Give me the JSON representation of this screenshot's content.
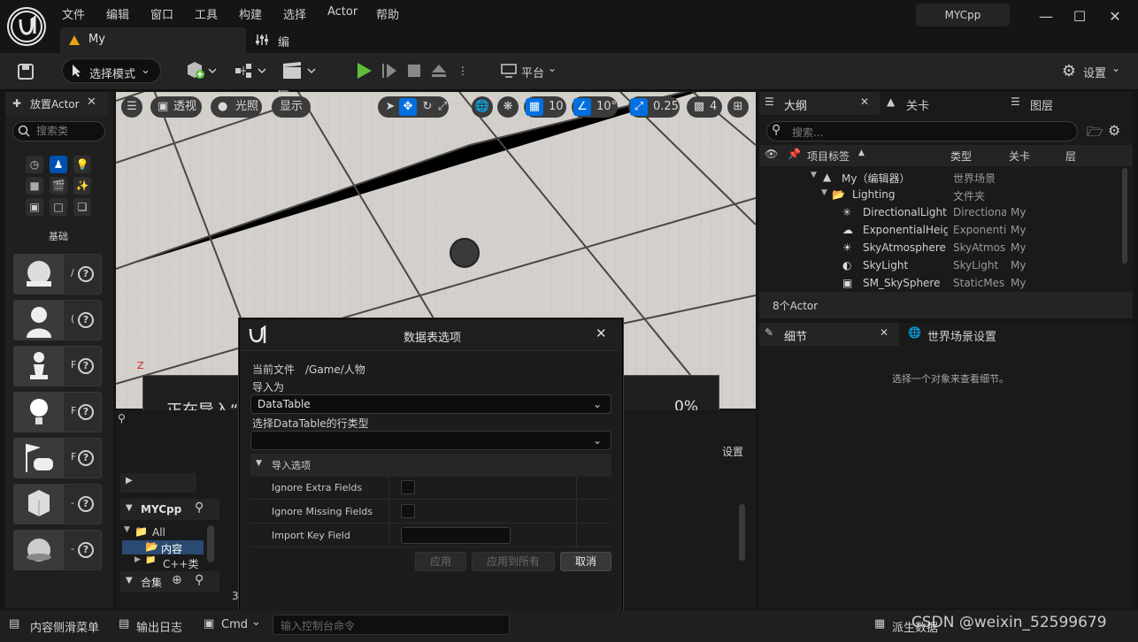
{
  "menu": [
    "文件",
    "编辑",
    "窗口",
    "工具",
    "构建",
    "选择",
    "Actor",
    "帮助"
  ],
  "tabs": {
    "level": "My",
    "prefs": "编辑器偏好设置"
  },
  "project_name": "MYCpp",
  "toolbar": {
    "mode": "选择模式",
    "platform": "平台",
    "settings": "设置"
  },
  "place_actors": {
    "title": "放置Actor",
    "search_placeholder": "搜索类",
    "category_label": "基础",
    "card_cuts": [
      "/",
      "(",
      "F",
      "F",
      "F",
      "-",
      "-"
    ]
  },
  "viewport": {
    "perspective": "透视",
    "lit": "光照",
    "show": "显示",
    "grid_snap": "10",
    "rot_snap": "10°",
    "scale_snap": "0.25",
    "camera_speed": "4"
  },
  "import_progress": {
    "label": "正在导入“",
    "percent": "0%"
  },
  "content": {
    "root": "MYCpp",
    "all": "All",
    "content": "内容",
    "cpp": "C++类",
    "collections": "合集",
    "settings_partial": "设置",
    "count_partial": "3"
  },
  "outliner": {
    "tab_outline": "大纲",
    "tab_levels": "关卡",
    "tab_layers": "图层",
    "search_placeholder": "搜索...",
    "columns": {
      "label": "项目标签",
      "type": "类型",
      "level": "关卡",
      "layer": "层"
    },
    "rows": [
      {
        "label": "My（编辑器）",
        "type": "世界场景",
        "level": ""
      },
      {
        "label": "Lighting",
        "type": "文件夹",
        "level": ""
      },
      {
        "label": "DirectionalLight",
        "type": "Directiona",
        "level": "My"
      },
      {
        "label": "ExponentialHeigl",
        "type": "Exponenti",
        "level": "My"
      },
      {
        "label": "SkyAtmosphere",
        "type": "SkyAtmos",
        "level": "My"
      },
      {
        "label": "SkyLight",
        "type": "SkyLight",
        "level": "My"
      },
      {
        "label": "SM_SkySphere",
        "type": "StaticMes",
        "level": "My"
      }
    ],
    "count": "8个Actor"
  },
  "details": {
    "tab_details": "细节",
    "tab_world": "世界场景设置",
    "empty_text": "选择一个对象来查看细节。"
  },
  "dialog": {
    "title": "数据表选项",
    "current_file_label": "当前文件",
    "current_file": "/Game/人物",
    "import_as_label": "导入为",
    "import_as_value": "DataTable",
    "row_type_label": "选择DataTable的行类型",
    "row_type_value": "",
    "section": "导入选项",
    "options": [
      {
        "name": "Ignore Extra Fields"
      },
      {
        "name": "Ignore Missing Fields"
      },
      {
        "name": "Import Key Field"
      }
    ],
    "btn_apply": "应用",
    "btn_apply_all": "应用到所有",
    "btn_cancel": "取消"
  },
  "bottom": {
    "drawer": "内容侧滑菜单",
    "output_log": "输出日志",
    "cmd": "Cmd",
    "console_placeholder": "输入控制台命令",
    "derived": "派生数据",
    "watermark": "CSDN @weixin_52599679"
  },
  "colors": {
    "accent": "#0070e0",
    "play_green": "#5fbf3a",
    "folder": "#c8a060"
  }
}
